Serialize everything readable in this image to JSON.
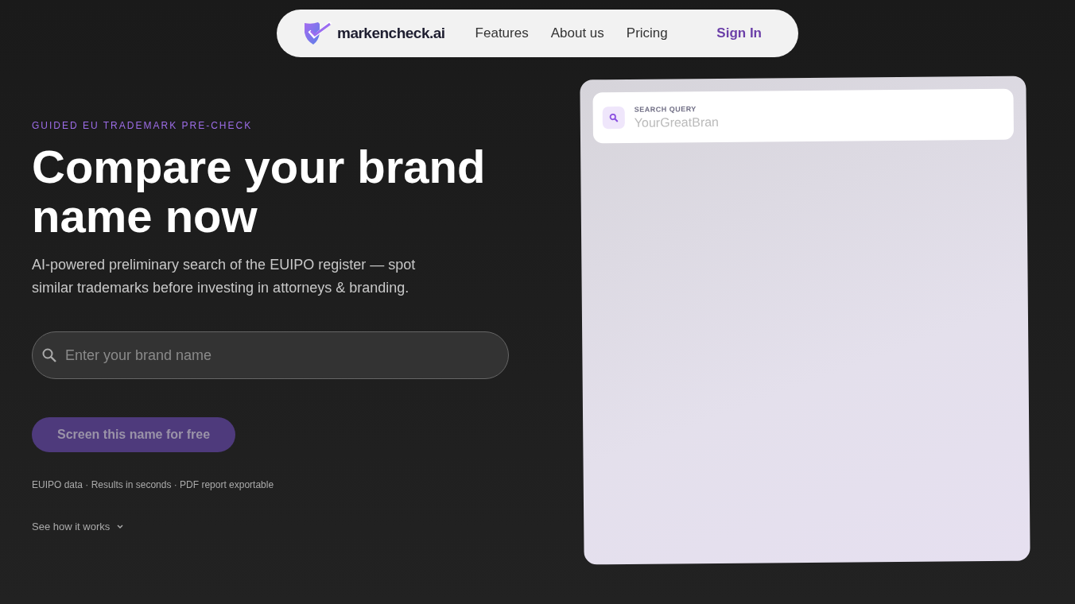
{
  "nav": {
    "brand": "markencheck.ai",
    "links": [
      "Features",
      "About us",
      "Pricing"
    ],
    "sign_in": "Sign In"
  },
  "hero": {
    "eyebrow": "GUIDED EU TRADEMARK PRE-CHECK",
    "title": "Compare your brand name now",
    "subtitle": "AI-powered preliminary search of the EUIPO register — spot similar trademarks before investing in attorneys & branding.",
    "search": {
      "placeholder": "Enter your brand name"
    },
    "button": {
      "label": "Screen this name for free",
      "disabled": true
    },
    "facts": "EUIPO data · Results in seconds · PDF report exportable",
    "more": "See how it works"
  },
  "preview": {
    "label": "SEARCH QUERY",
    "value": "YourGreatBran"
  }
}
